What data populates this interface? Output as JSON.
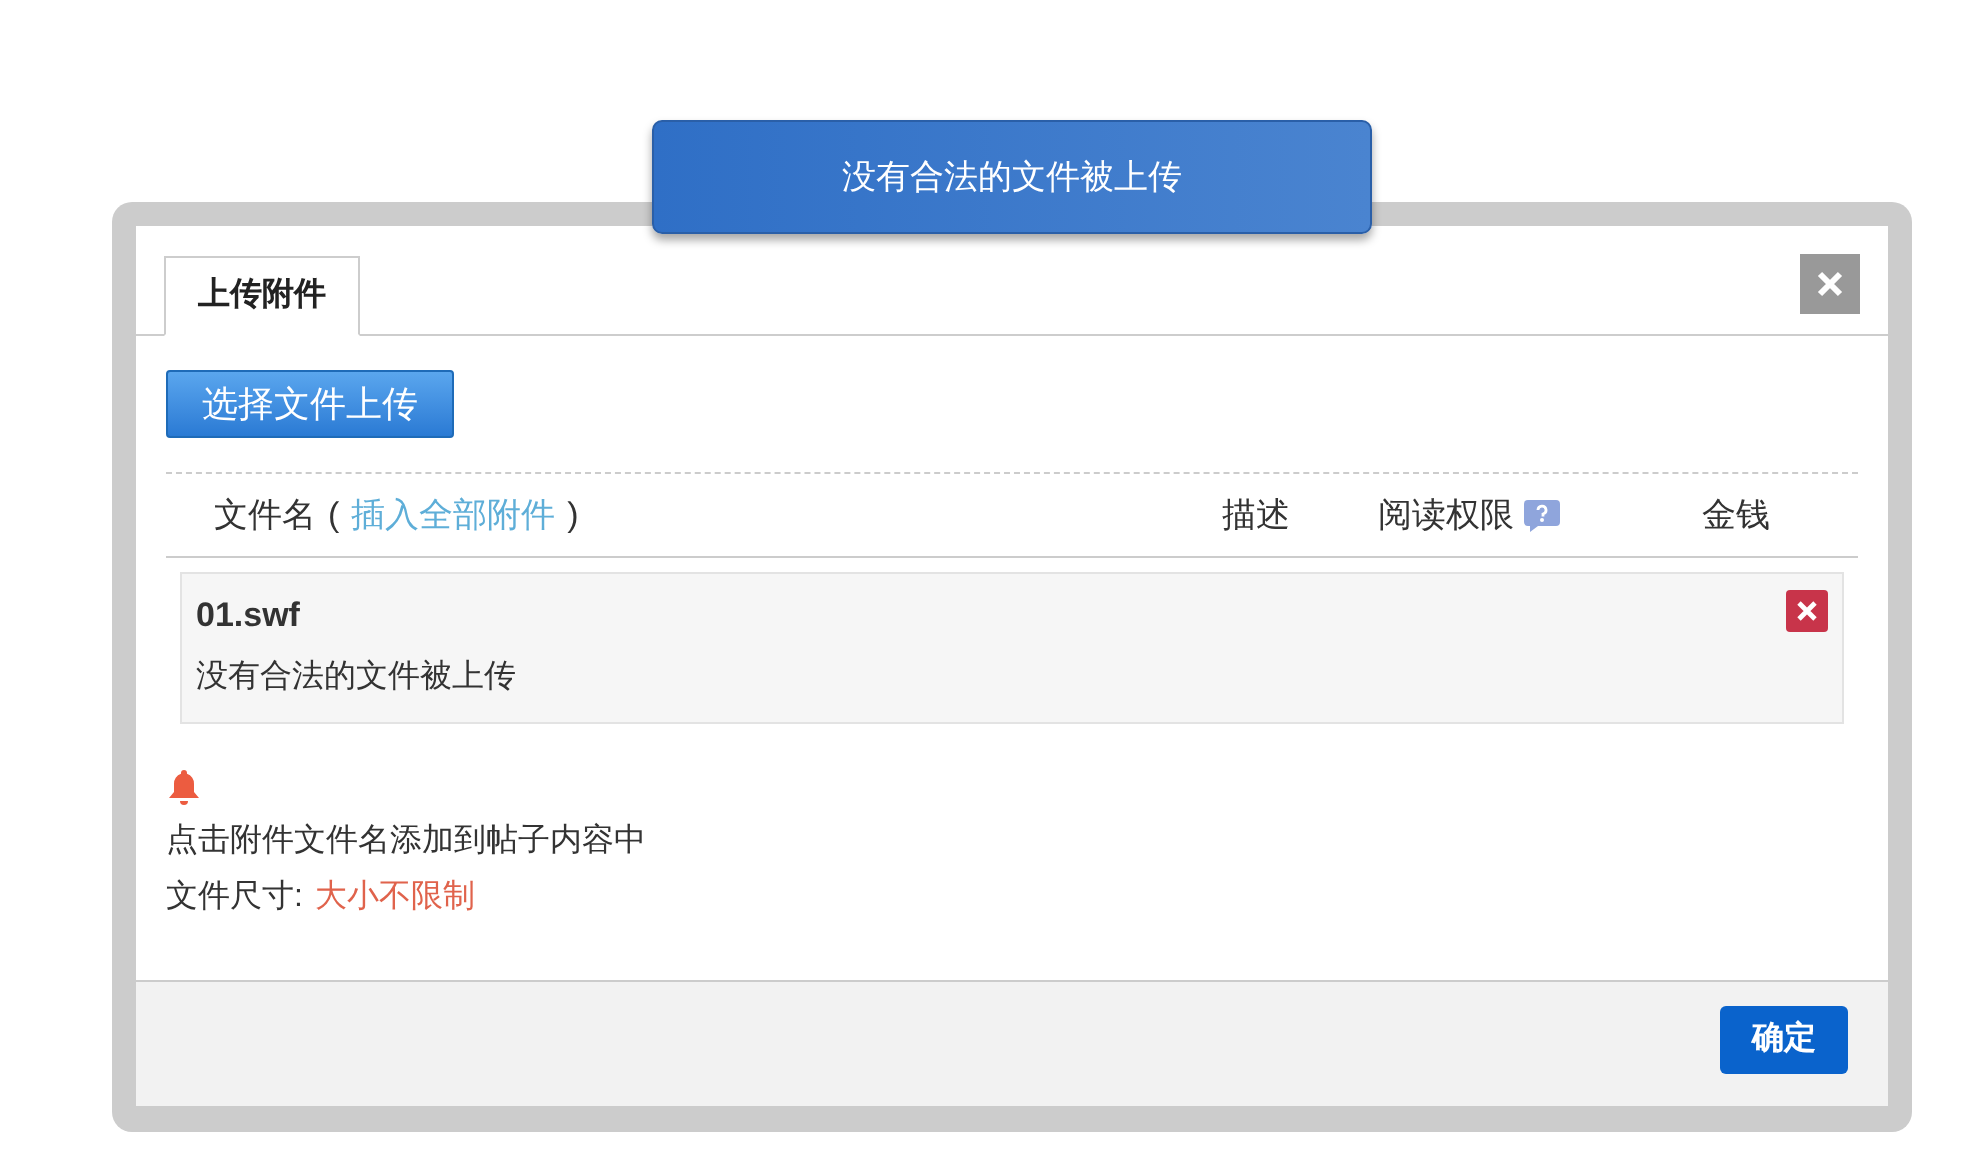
{
  "toast": {
    "message": "没有合法的文件被上传"
  },
  "tabs": [
    {
      "label": "上传附件",
      "selected": true
    }
  ],
  "upload_button": "选择文件上传",
  "header": {
    "filename": "文件名",
    "paren_open": "(",
    "insert_all_link": "插入全部附件",
    "paren_close": ")",
    "description": "描述",
    "permission": "阅读权限",
    "money": "金钱"
  },
  "files": [
    {
      "name": "01.swf",
      "status": "没有合法的文件被上传"
    }
  ],
  "notes": {
    "hint": "点击附件文件名添加到帖子内容中",
    "size_label": "文件尺寸:",
    "size_value": "大小不限制"
  },
  "footer": {
    "confirm_button": "确定"
  }
}
